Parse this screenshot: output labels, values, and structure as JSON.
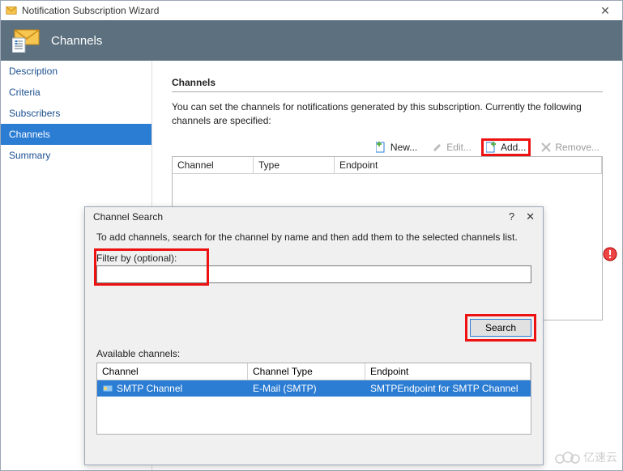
{
  "window": {
    "title": "Notification Subscription Wizard"
  },
  "header": {
    "title": "Channels"
  },
  "sidebar": {
    "items": [
      {
        "label": "Description",
        "active": false
      },
      {
        "label": "Criteria",
        "active": false
      },
      {
        "label": "Subscribers",
        "active": false
      },
      {
        "label": "Channels",
        "active": true
      },
      {
        "label": "Summary",
        "active": false
      }
    ]
  },
  "main": {
    "section_title": "Channels",
    "description": "You can set the channels for notifications generated by this subscription.  Currently the following channels are specified:",
    "toolbar": {
      "new": "New...",
      "edit": "Edit...",
      "add": "Add...",
      "remove": "Remove..."
    },
    "grid": {
      "columns": {
        "channel": "Channel",
        "type": "Type",
        "endpoint": "Endpoint"
      }
    }
  },
  "dialog": {
    "title": "Channel Search",
    "help": "?",
    "close": "✕",
    "instruction": "To add channels, search for the channel by name and then add them to the selected channels list.",
    "filter_label": "Filter by (optional):",
    "filter_value": "",
    "search_label": "Search",
    "available_label": "Available channels:",
    "columns": {
      "channel": "Channel",
      "type": "Channel Type",
      "endpoint": "Endpoint"
    },
    "rows": [
      {
        "channel": "SMTP Channel",
        "type": "E-Mail (SMTP)",
        "endpoint": "SMTPEndpoint for SMTP Channel"
      }
    ]
  },
  "watermark": "亿速云"
}
